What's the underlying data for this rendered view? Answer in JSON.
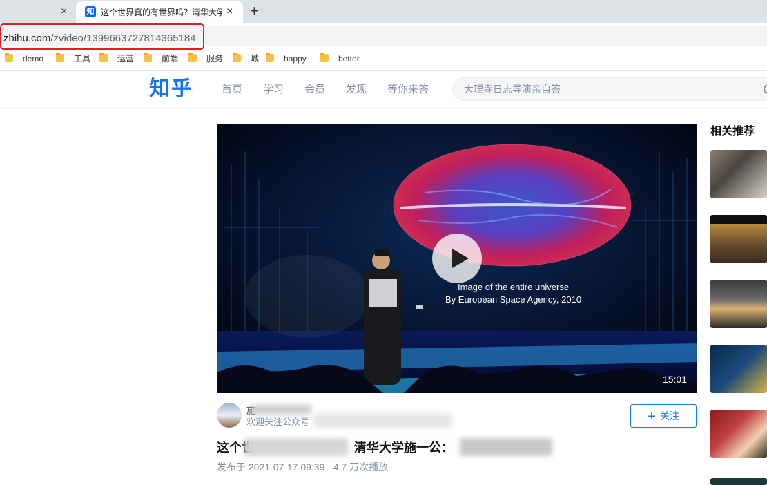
{
  "browser": {
    "prev_tab_close": "×",
    "active_tab": {
      "favicon": "知",
      "title": "这个世界真的有世界吗？清华大学",
      "close": "×"
    },
    "new_tab": "+",
    "url_host": "zhihu.com",
    "url_path": "/zvideo/1399663727814365184",
    "bookmarks": [
      "demo",
      "工具",
      "运营",
      "前端",
      "服务",
      "城",
      "happy",
      "better"
    ]
  },
  "header": {
    "logo": "知乎",
    "nav": [
      "首页",
      "学习",
      "会员",
      "发现",
      "等你来答"
    ],
    "search_placeholder": "大理寺日志导演亲自答"
  },
  "video": {
    "caption_line1": "Image of the entire universe",
    "caption_line2": "By European Space Agency, 2010",
    "duration": "15:01"
  },
  "author": {
    "name": "施",
    "desc": "欢迎关注公众号"
  },
  "follow_label": "关注",
  "title_part1": "这个世",
  "title_part2": "清华大学施一公：",
  "meta": "发布于 2021-07-17 09:39 · 4.7 万次播放",
  "related": {
    "title": "相关推荐"
  },
  "colors": {
    "brand": "#1772f6",
    "highlight": "#e02020"
  }
}
